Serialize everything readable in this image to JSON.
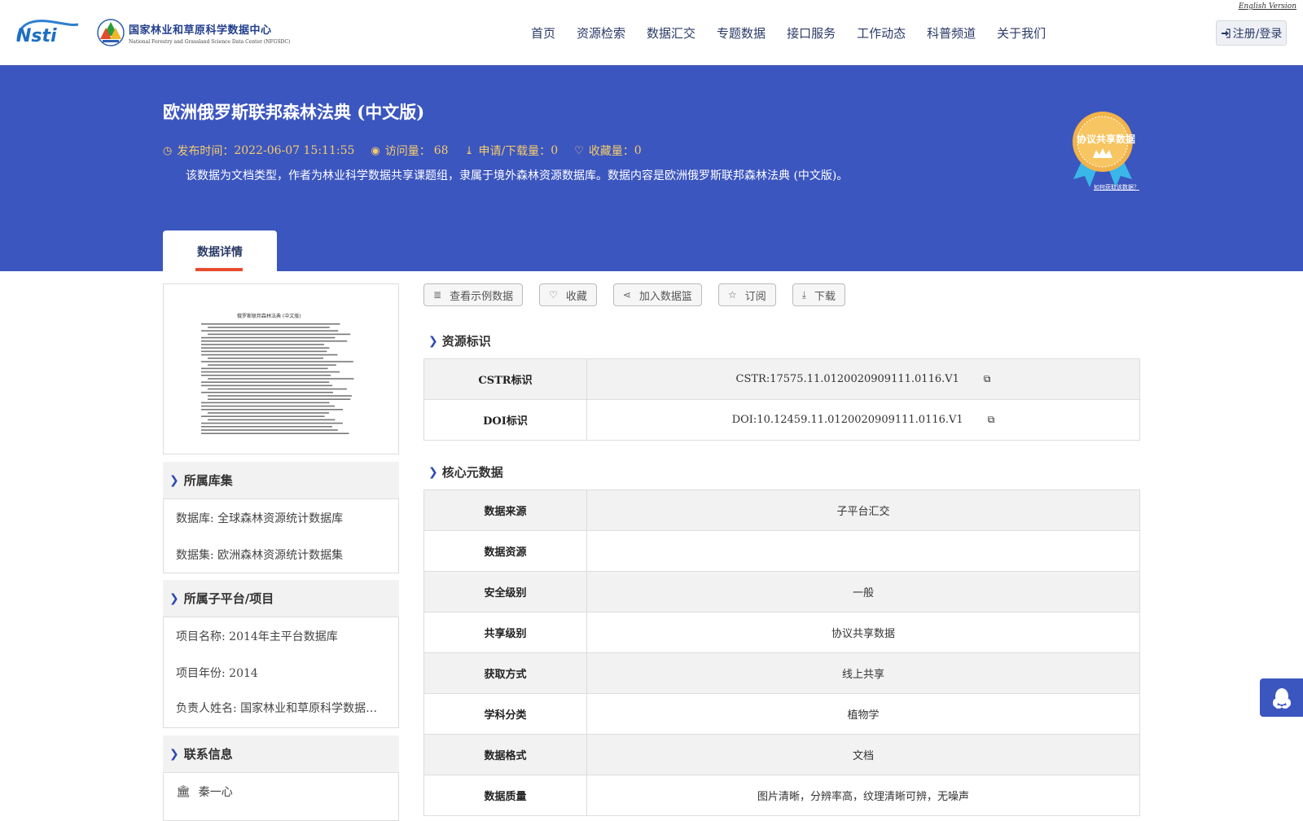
{
  "header": {
    "english_link": "English Version",
    "logo_cn": "国家林业和草原科学数据中心",
    "logo_en": "National Forestry and Grassland Science Data Center (NFGSDC)",
    "nav": [
      "首页",
      "资源检索",
      "数据汇交",
      "专题数据",
      "接口服务",
      "工作动态",
      "科普频道",
      "关于我们"
    ],
    "login": "注册/登录"
  },
  "banner": {
    "title": "欧洲俄罗斯联邦森林法典 (中文版)",
    "publish_label": "发布时间：",
    "publish_time": "2022-06-07 15:11:55",
    "visits_label": "访问量：",
    "visits": "68",
    "downloads_label": "申请/下载量：",
    "downloads": "0",
    "favorites_label": "收藏量：",
    "favorites": "0",
    "description": "该数据为文档类型，作者为林业科学数据共享课题组，隶属于境外森林资源数据库。数据内容是欧洲俄罗斯联邦森林法典 (中文版)。",
    "badge": "协议共享数据",
    "how_to": "如何获取该数据？",
    "tab": "数据详情"
  },
  "actions": [
    "查看示例数据",
    "收藏",
    "加入数据篮",
    "订阅",
    "下载"
  ],
  "thumbnail": {
    "doc_title": "俄罗斯联邦森林法典 (中文版)"
  },
  "library": {
    "title": "所属库集",
    "rows": [
      "数据库: 全球森林资源统计数据库",
      "数据集: 欧洲森林资源统计数据集"
    ]
  },
  "platform": {
    "title": "所属子平台/项目",
    "rows": [
      "项目名称: 2014年主平台数据库",
      "项目年份: 2014",
      "负责人姓名: 国家林业和草原科学数据中心"
    ]
  },
  "contact": {
    "title": "联系信息",
    "name": "秦一心"
  },
  "resource_id": {
    "title": "资源标识",
    "rows": [
      {
        "label": "CSTR标识",
        "value": "CSTR:17575.11.0120020909111.0116.V1"
      },
      {
        "label": "DOI标识",
        "value": "DOI:10.12459.11.0120020909111.0116.V1"
      }
    ]
  },
  "core_meta": {
    "title": "核心元数据",
    "rows": [
      {
        "label": "数据来源",
        "value": "子平台汇交"
      },
      {
        "label": "数据资源",
        "value": ""
      },
      {
        "label": "安全级别",
        "value": "一般"
      },
      {
        "label": "共享级别",
        "value": "协议共享数据"
      },
      {
        "label": "获取方式",
        "value": "线上共享"
      },
      {
        "label": "学科分类",
        "value": "植物学"
      },
      {
        "label": "数据格式",
        "value": "文档"
      },
      {
        "label": "数据质量",
        "value": "图片清晰，分辨率高，纹理清晰可辨，无噪声"
      }
    ]
  },
  "colors": {
    "banner": "#3c56bf",
    "meta_text": "#f4cc6a",
    "accent_red": "#e84a2f"
  }
}
